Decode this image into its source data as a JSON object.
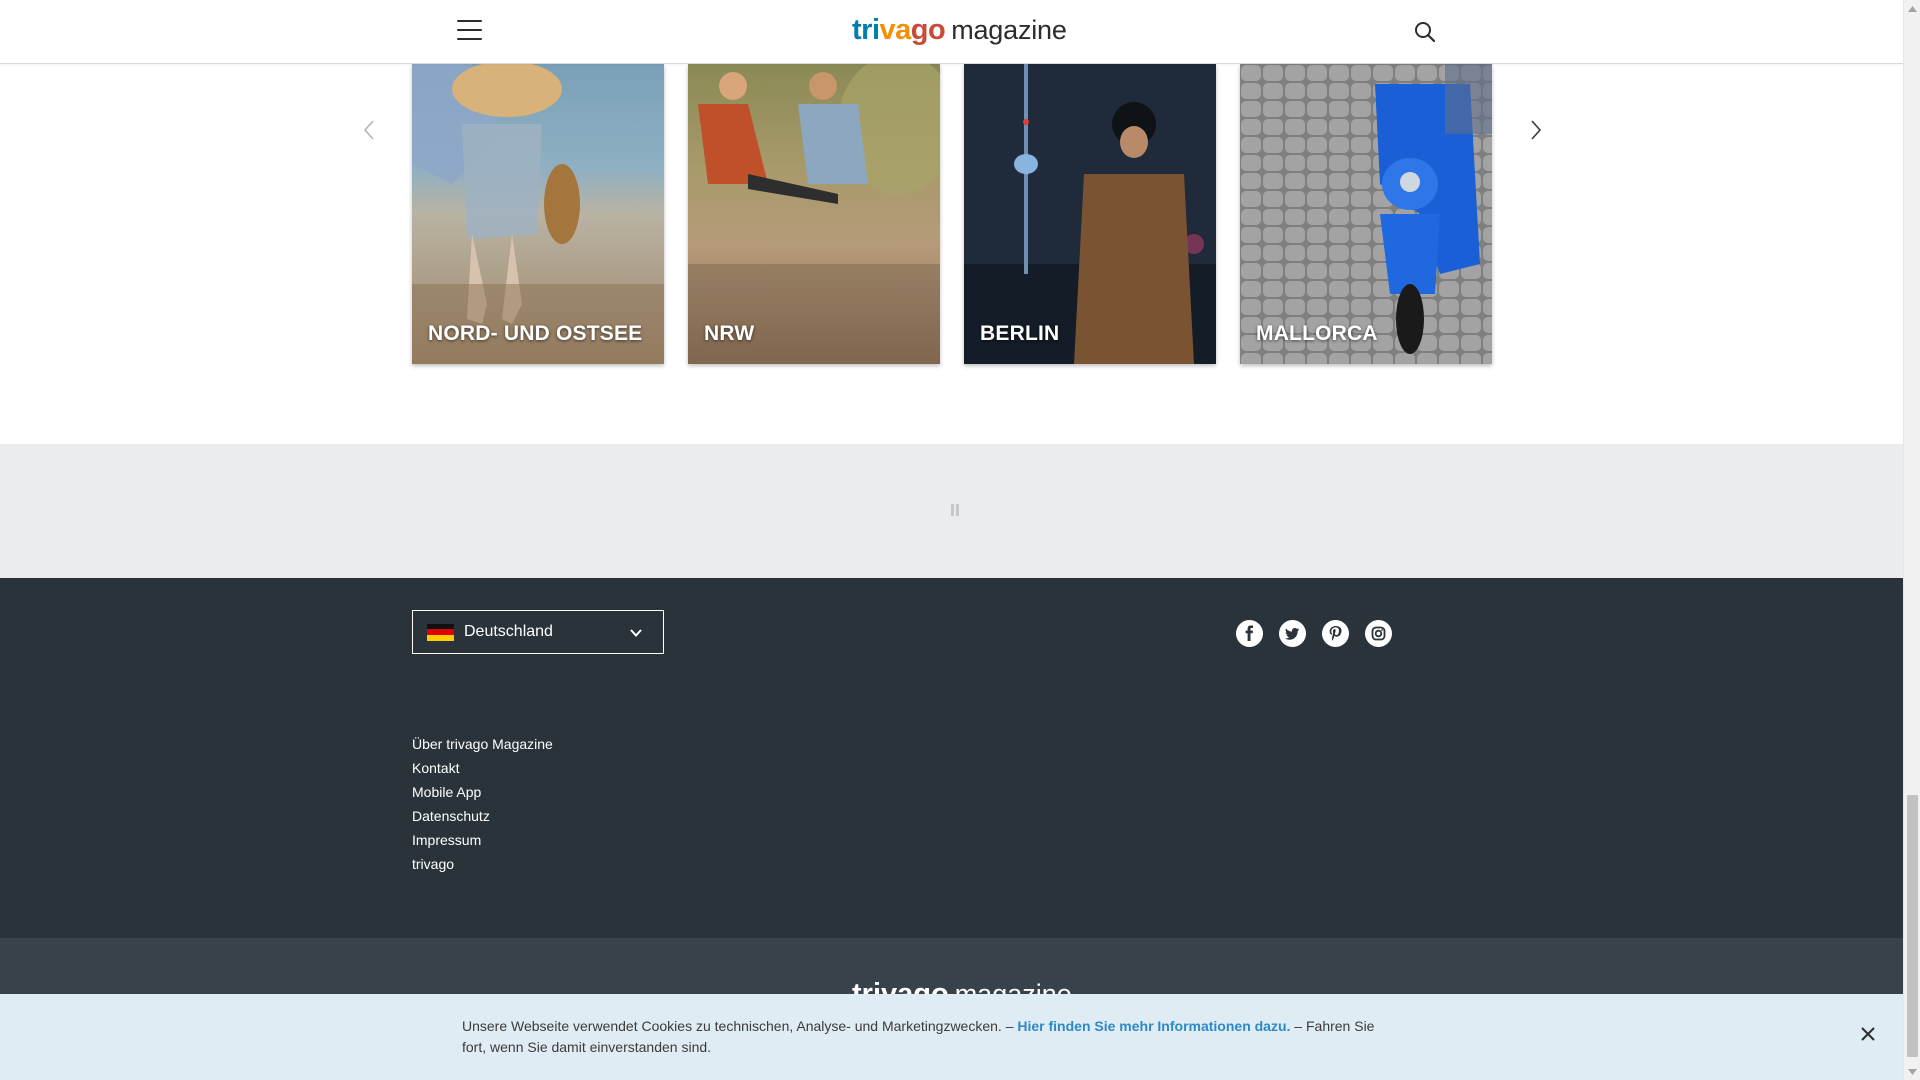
{
  "header": {
    "logo_part1": "trivago",
    "logo_part2": "magazine",
    "brand_colors": [
      "#007fad",
      "#f48f00",
      "#c94a38"
    ]
  },
  "carousel": {
    "cards": [
      {
        "label": "NORD- UND OSTSEE"
      },
      {
        "label": "NRW"
      },
      {
        "label": "BERLIN"
      },
      {
        "label": "MALLORCA"
      }
    ]
  },
  "footer": {
    "country": "Deutschland",
    "social_icons": [
      "facebook-icon",
      "twitter-icon",
      "pinterest-icon",
      "instagram-icon"
    ],
    "links": [
      "Über trivago Magazine",
      "Kontakt",
      "Mobile App",
      "Datenschutz",
      "Impressum",
      "trivago"
    ],
    "bottom_logo_part1": "trivago",
    "bottom_logo_part2": "magazine"
  },
  "cookie": {
    "text_before": "Unsere Webseite verwendet Cookies zu technischen, Analyse- und Marketingzwecken. – ",
    "link_text": "Hier finden Sie mehr Informationen dazu.",
    "text_after": " – Fahren Sie fort, wenn Sie damit einverstanden sind."
  },
  "colors": {
    "footer_bg": "#2a333a",
    "footer_bottom_bg": "#37424a",
    "cookie_bg": "#e0ecf3",
    "cookie_link": "#2d8ac6",
    "ad_band_bg": "#ebeced"
  }
}
